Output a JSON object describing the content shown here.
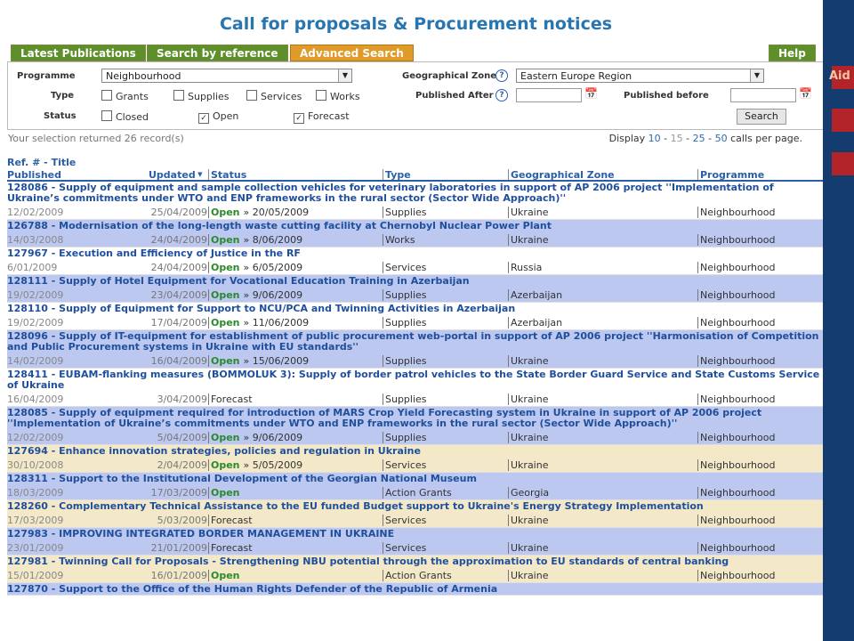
{
  "page": {
    "title": "Call for proposals & Procurement notices",
    "side_label": "Aid"
  },
  "colors": {
    "accent": "#2876b0",
    "tab_green": "#5e8f2a",
    "tab_orange": "#e09a28",
    "row_alt": "#bcc8ef",
    "row_cream": "#f3e8c8",
    "side_bar": "#143c6e"
  },
  "tabs": {
    "latest": "Latest Publications",
    "by_ref": "Search by reference",
    "advanced": "Advanced Search",
    "help": "Help"
  },
  "form": {
    "programme_label": "Programme",
    "programme_value": "Neighbourhood",
    "geo_label": "Geographical Zone",
    "geo_value": "Eastern Europe Region",
    "type_label": "Type",
    "types": [
      "Grants",
      "Supplies",
      "Services",
      "Works"
    ],
    "status_label": "Status",
    "statuses": [
      {
        "label": "Closed",
        "checked": false
      },
      {
        "label": "Open",
        "checked": true
      },
      {
        "label": "Forecast",
        "checked": true
      }
    ],
    "published_after_label": "Published After",
    "published_before_label": "Published before",
    "search_button": "Search"
  },
  "results": {
    "summary": "Your selection returned 26 record(s)",
    "display_prefix": "Display",
    "page_sizes": [
      "10",
      "15",
      "25",
      "50"
    ],
    "display_suffix": "calls per page.",
    "sep": "-"
  },
  "columns": {
    "ref_title": "Ref. # - Title",
    "published": "Published",
    "updated": "Updated",
    "status": "Status",
    "type": "Type",
    "geo": "Geographical Zone",
    "programme": "Programme"
  },
  "rows": [
    {
      "title": "128086 - Supply of equipment and sample collection vehicles for veterinary laboratories in support of AP 2006 project ''Implementation of Ukraine’s commitments under WTO and ENP frameworks in the rural sector (Sector Wide Approach)''",
      "published": "12/02/2009",
      "updated": "25/04/2009",
      "status": "Open",
      "deadline": "» 20/05/2009",
      "type": "Supplies",
      "zone": "Ukraine",
      "programme": "Neighbourhood",
      "style": "white"
    },
    {
      "title": "126788 - Modernisation of the long-length waste cutting facility at Chernobyl Nuclear Power Plant",
      "published": "14/03/2008",
      "updated": "24/04/2009",
      "status": "Open",
      "deadline": "» 8/06/2009",
      "type": "Works",
      "zone": "Ukraine",
      "programme": "Neighbourhood",
      "style": "alt"
    },
    {
      "title": "127967 - Execution and Efficiency of Justice in the RF",
      "published": "6/01/2009",
      "updated": "24/04/2009",
      "status": "Open",
      "deadline": "» 6/05/2009",
      "type": "Services",
      "zone": "Russia",
      "programme": "Neighbourhood",
      "style": "white"
    },
    {
      "title": "128111 - Supply of Hotel Equipment for Vocational Education Training in Azerbaijan",
      "published": "19/02/2009",
      "updated": "23/04/2009",
      "status": "Open",
      "deadline": "» 9/06/2009",
      "type": "Supplies",
      "zone": "Azerbaijan",
      "programme": "Neighbourhood",
      "style": "alt"
    },
    {
      "title": "128110 - Supply of Equipment for Support to NCU/PCA and Twinning Activities in Azerbaijan",
      "published": "19/02/2009",
      "updated": "17/04/2009",
      "status": "Open",
      "deadline": "» 11/06/2009",
      "type": "Supplies",
      "zone": "Azerbaijan",
      "programme": "Neighbourhood",
      "style": "white"
    },
    {
      "title": "128096 - Supply of IT-equipment for establishment of public procurement web-portal in support of AP 2006 project ''Harmonisation of Competition and Public Procurement systems in Ukraine with EU standards''",
      "published": "14/02/2009",
      "updated": "16/04/2009",
      "status": "Open",
      "deadline": "» 15/06/2009",
      "type": "Supplies",
      "zone": "Ukraine",
      "programme": "Neighbourhood",
      "style": "alt"
    },
    {
      "title": "128411 - EUBAM-flanking measures (BOMMOLUK 3): Supply of border patrol vehicles to the State Border Guard Service and State Customs Service of Ukraine",
      "published": "16/04/2009",
      "updated": "3/04/2009",
      "status": "Forecast",
      "deadline": "",
      "type": "Supplies",
      "zone": "Ukraine",
      "programme": "Neighbourhood",
      "style": "white"
    },
    {
      "title": "128085 - Supply of equipment required for introduction of MARS Crop Yield Forecasting system in Ukraine in support of AP 2006 project ''Implementation of Ukraine’s commitments under WTO and ENP frameworks in the rural sector (Sector Wide Approach)''",
      "published": "12/02/2009",
      "updated": "5/04/2009",
      "status": "Open",
      "deadline": "» 9/06/2009",
      "type": "Supplies",
      "zone": "Ukraine",
      "programme": "Neighbourhood",
      "style": "alt"
    },
    {
      "title": "127694 - Enhance innovation strategies, policies and regulation in Ukraine",
      "published": "30/10/2008",
      "updated": "2/04/2009",
      "status": "Open",
      "deadline": "» 5/05/2009",
      "type": "Services",
      "zone": "Ukraine",
      "programme": "Neighbourhood",
      "style": "cream"
    },
    {
      "title": "128311 - Support to the Institutional Development of the Georgian National Museum",
      "published": "18/03/2009",
      "updated": "17/03/2009",
      "status": "Open",
      "deadline": "",
      "type": "Action Grants",
      "zone": "Georgia",
      "programme": "Neighbourhood",
      "style": "alt"
    },
    {
      "title": "128260 - Complementary Technical Assistance to the EU funded Budget support to Ukraine's Energy Strategy Implementation",
      "published": "17/03/2009",
      "updated": "5/03/2009",
      "status": "Forecast",
      "deadline": "",
      "type": "Services",
      "zone": "Ukraine",
      "programme": "Neighbourhood",
      "style": "cream"
    },
    {
      "title": "127983 - IMPROVING INTEGRATED BORDER MANAGEMENT IN UKRAINE",
      "published": "23/01/2009",
      "updated": "21/01/2009",
      "status": "Forecast",
      "deadline": "",
      "type": "Services",
      "zone": "Ukraine",
      "programme": "Neighbourhood",
      "style": "alt"
    },
    {
      "title": "127981 - Twinning Call for Proposals - Strengthening NBU potential through the approximation to EU standards of central banking",
      "published": "15/01/2009",
      "updated": "16/01/2009",
      "status": "Open",
      "deadline": "",
      "type": "Action Grants",
      "zone": "Ukraine",
      "programme": "Neighbourhood",
      "style": "cream"
    },
    {
      "title": "127870 - Support to the Office of the Human Rights Defender of the Republic of Armenia",
      "published": "",
      "updated": "",
      "status": "",
      "deadline": "",
      "type": "",
      "zone": "",
      "programme": "",
      "style": "alt"
    }
  ]
}
